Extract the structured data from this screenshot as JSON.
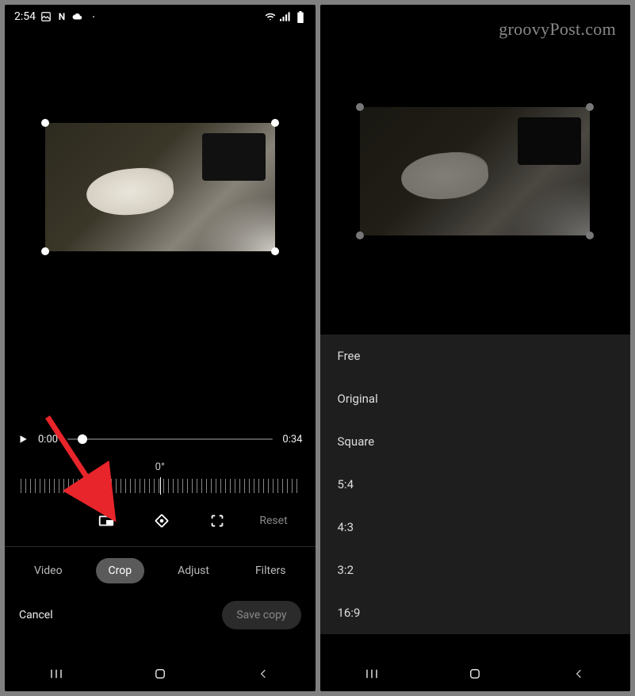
{
  "watermark": "groovyPost.com",
  "left": {
    "status": {
      "time": "2:54",
      "icons_left": [
        "image-icon",
        "n-icon",
        "cloud-icon",
        "dot-icon"
      ],
      "icons_right": [
        "wifi-icon",
        "signal-icon",
        "battery-icon"
      ]
    },
    "timeline": {
      "current": "0:00",
      "duration": "0:34"
    },
    "angle": "0°",
    "tools": {
      "aspect_ratio": "aspect-ratio-icon",
      "rotate": "rotate-icon",
      "transform": "transform-icon",
      "reset": "Reset"
    },
    "tabs": {
      "video": "Video",
      "crop": "Crop",
      "adjust": "Adjust",
      "filters": "Filters",
      "active": "Crop"
    },
    "actions": {
      "cancel": "Cancel",
      "save": "Save copy"
    }
  },
  "right": {
    "aspect_options": [
      "Free",
      "Original",
      "Square",
      "5:4",
      "4:3",
      "3:2",
      "16:9"
    ]
  }
}
